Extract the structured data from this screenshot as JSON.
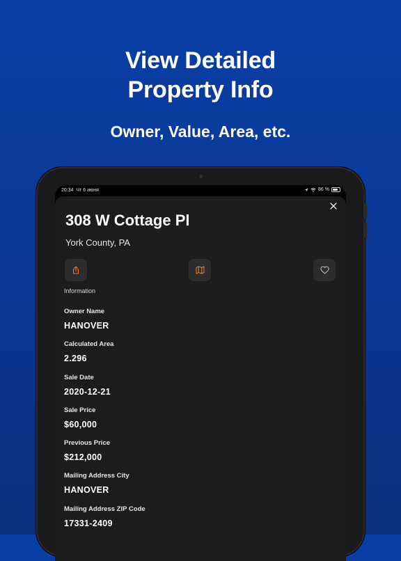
{
  "promo": {
    "headline_line1": "View Detailed",
    "headline_line2": "Property Info",
    "subheadline": "Owner, Value, Area, etc."
  },
  "status_bar": {
    "time": "20:34",
    "date": "Чт 6 июня",
    "battery": "86 %"
  },
  "property": {
    "address": "308 W Cottage Pl",
    "county": "York County, PA"
  },
  "actions": {
    "share_icon": "share-icon",
    "map_icon": "map-icon",
    "favorite_icon": "heart-icon",
    "accent_color": "#e8762b"
  },
  "info_section_label": "Information",
  "fields": [
    {
      "label": "Owner Name",
      "value": "HANOVER"
    },
    {
      "label": "Calculated Area",
      "value": "2.296"
    },
    {
      "label": "Sale Date",
      "value": "2020-12-21"
    },
    {
      "label": "Sale Price",
      "value": "$60,000"
    },
    {
      "label": "Previous Price",
      "value": "$212,000"
    },
    {
      "label": "Mailing Address City",
      "value": "HANOVER"
    },
    {
      "label": "Mailing Address ZIP Code",
      "value": "17331-2409"
    }
  ]
}
